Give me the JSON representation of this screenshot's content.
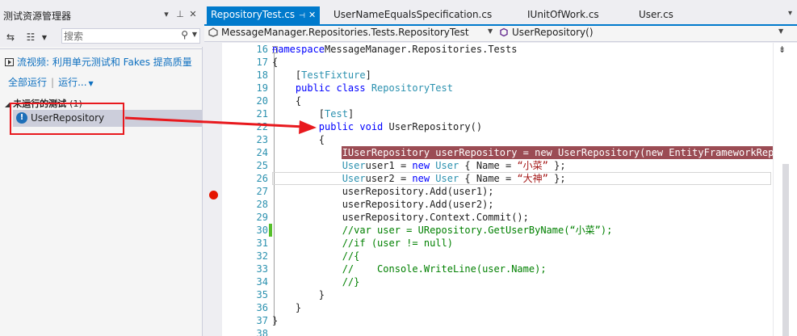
{
  "colors": {
    "accent": "#007acc",
    "breakpoint": "#e51400",
    "annotation": "#e8191e",
    "breakpoint_line": "#9b4c54"
  },
  "explorer": {
    "title": "测试资源管理器",
    "title_icons": [
      "dropdown-icon",
      "pin-icon",
      "close-icon"
    ],
    "search": {
      "placeholder": "搜索",
      "value": ""
    },
    "video_link": "流视频: 利用单元测试和 Fakes 提高质量",
    "run_all": "全部运行",
    "run": "运行...",
    "group": {
      "title": "未运行的测试",
      "count": "(1)"
    },
    "tests": [
      {
        "name": "UserRepository",
        "status": "not-run"
      }
    ]
  },
  "tabs": [
    {
      "label": "RepositoryTest.cs",
      "active": true
    },
    {
      "label": "UserNameEqualsSpecification.cs",
      "active": false
    },
    {
      "label": "IUnitOfWork.cs",
      "active": false
    },
    {
      "label": "User.cs",
      "active": false
    }
  ],
  "navbar": {
    "type": "MessageManager.Repositories.Tests.RepositoryTest",
    "member": "UserRepository()"
  },
  "editor": {
    "line_numbers": [
      "16",
      "17",
      "18",
      "19",
      "20",
      "21",
      "22",
      "23",
      "24",
      "25",
      "26",
      "27",
      "28",
      "29",
      "30",
      "31",
      "32",
      "33",
      "34",
      "35",
      "36",
      "37",
      "38"
    ],
    "lines": [
      [
        [
          "kw",
          "namespace"
        ],
        [
          "",
          "MessageManager.Repositories.Tests"
        ]
      ],
      [
        [
          "",
          "{"
        ]
      ],
      [
        [
          "",
          "    ["
        ],
        [
          "ty",
          "TestFixture"
        ],
        [
          "",
          "]"
        ]
      ],
      [
        [
          "kw",
          "    public class "
        ],
        [
          "ty",
          "RepositoryTest"
        ]
      ],
      [
        [
          "",
          "    {"
        ]
      ],
      [
        [
          "",
          "        ["
        ],
        [
          "ty",
          "Test"
        ],
        [
          "",
          "]"
        ]
      ],
      [
        [
          "kw",
          "        public void "
        ],
        [
          "",
          "UserRepository()"
        ]
      ],
      [
        [
          "",
          "        {"
        ]
      ],
      [
        [
          "",
          "            IUserRepository userRepository = new UserRepository(new EntityFrameworkRepos"
        ]
      ],
      [
        [
          "ty",
          "            User"
        ],
        [
          "",
          "user1 = "
        ],
        [
          "kw",
          "new "
        ],
        [
          "ty",
          "User"
        ],
        [
          "",
          " { Name = "
        ],
        [
          "st",
          "“小菜”"
        ],
        [
          "",
          " };"
        ]
      ],
      [
        [
          "ty",
          "            User"
        ],
        [
          "",
          "user2 = "
        ],
        [
          "kw",
          "new "
        ],
        [
          "ty",
          "User"
        ],
        [
          "",
          " { Name = "
        ],
        [
          "st",
          "“大神”"
        ],
        [
          "",
          " };"
        ]
      ],
      [
        [
          "",
          "            userRepository.Add(user1);"
        ]
      ],
      [
        [
          "",
          "            userRepository.Add(user2);"
        ]
      ],
      [
        [
          "",
          "            userRepository.Context.Commit();"
        ]
      ],
      [
        [
          "cm",
          "            //var user = URepository.GetUserByName(“小菜”);"
        ]
      ],
      [
        [
          "cm",
          "            //if (user != null)"
        ]
      ],
      [
        [
          "cm",
          "            //{"
        ]
      ],
      [
        [
          "cm",
          "            //    Console.WriteLine(user.Name);"
        ]
      ],
      [
        [
          "cm",
          "            //}"
        ]
      ],
      [
        [
          "",
          "        }"
        ]
      ],
      [
        [
          "",
          "    }"
        ]
      ],
      [
        [
          "",
          "}"
        ]
      ],
      [
        [
          "",
          ""
        ]
      ]
    ]
  }
}
